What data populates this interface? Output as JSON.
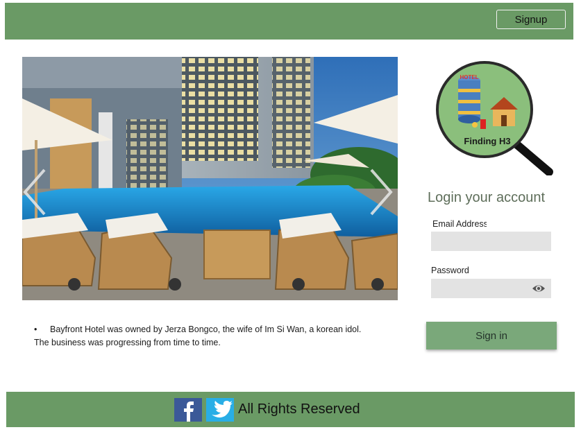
{
  "header": {
    "signup_label": "Signup"
  },
  "carousel": {
    "caption_bullet": "•",
    "caption": "Bayfront Hotel was owned by Jerza Bongco, the wife of Im Si Wan, a korean idol.",
    "caption_line2": "The business was progressing from time to time."
  },
  "logo": {
    "top_text": "HOTEL",
    "name": "Finding H3"
  },
  "login": {
    "title": "Login your account",
    "email_label": "Email Address",
    "email_value": "",
    "password_label": "Password",
    "password_value": "",
    "signin_label": "Sign in"
  },
  "footer": {
    "text": "All Rights Reserved"
  },
  "icons": {
    "prev": "chevron-left-icon",
    "next": "chevron-right-icon",
    "eye": "eye-icon",
    "facebook": "facebook-icon",
    "twitter": "twitter-icon"
  },
  "colors": {
    "header_bg": "#6a9a65",
    "footer_bg": "#6a9a65",
    "signin_bg": "#7aa87a",
    "input_bg": "#e3e3e3",
    "facebook": "#3b5998",
    "twitter": "#29aee6"
  }
}
